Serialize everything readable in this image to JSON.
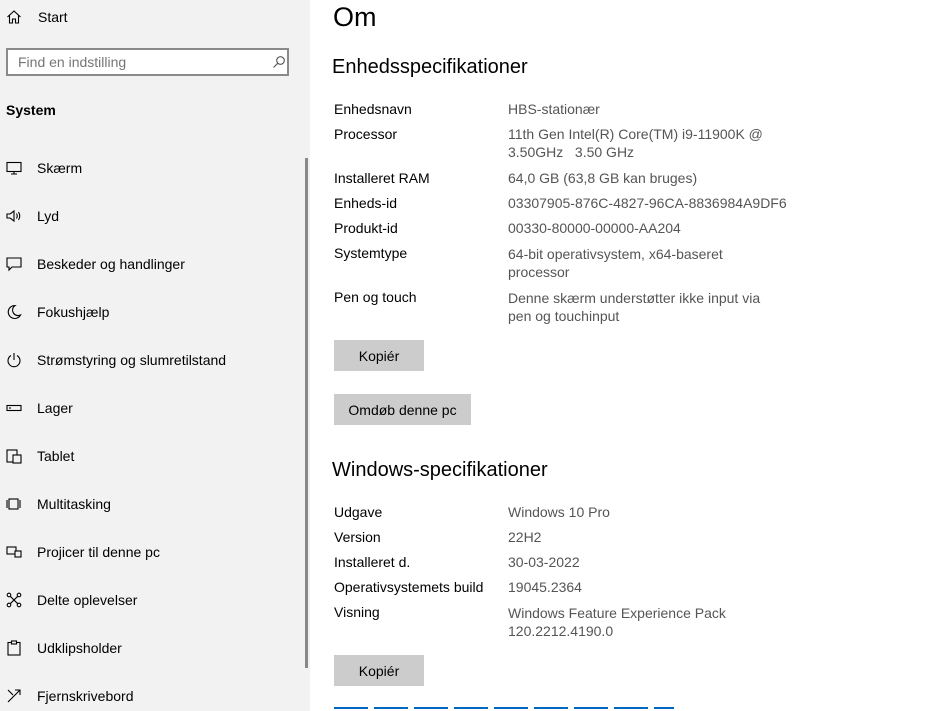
{
  "sidebar": {
    "home_label": "Start",
    "search_placeholder": "Find en indstilling",
    "section_title": "System",
    "items": [
      {
        "label": "Skærm",
        "icon": "monitor-icon"
      },
      {
        "label": "Lyd",
        "icon": "speaker-icon"
      },
      {
        "label": "Beskeder og handlinger",
        "icon": "message-icon"
      },
      {
        "label": "Fokushjælp",
        "icon": "moon-icon"
      },
      {
        "label": "Strømstyring og slumretilstand",
        "icon": "power-icon"
      },
      {
        "label": "Lager",
        "icon": "storage-icon"
      },
      {
        "label": "Tablet",
        "icon": "tablet-icon"
      },
      {
        "label": "Multitasking",
        "icon": "multitasking-icon"
      },
      {
        "label": "Projicer til denne pc",
        "icon": "project-icon"
      },
      {
        "label": "Delte oplevelser",
        "icon": "shared-experiences-icon"
      },
      {
        "label": "Udklipsholder",
        "icon": "clipboard-icon"
      },
      {
        "label": "Fjernskrivebord",
        "icon": "remote-desktop-icon"
      }
    ]
  },
  "main": {
    "title": "Om",
    "device_specs": {
      "heading": "Enhedsspecifikationer",
      "rows": [
        {
          "label": "Enhedsnavn",
          "value": [
            "HBS-stationær"
          ]
        },
        {
          "label": "Processor",
          "value": [
            "11th Gen Intel(R) Core(TM) i9-11900K @",
            "3.50GHz   3.50 GHz"
          ]
        },
        {
          "label": "Installeret RAM",
          "value": [
            "64,0 GB (63,8 GB kan bruges)"
          ]
        },
        {
          "label": "Enheds-id",
          "value": [
            "03307905-876C-4827-96CA-8836984A9DF6"
          ]
        },
        {
          "label": "Produkt-id",
          "value": [
            "00330-80000-00000-AA204"
          ]
        },
        {
          "label": "Systemtype",
          "value": [
            "64-bit operativsystem, x64-baseret",
            "processor"
          ]
        },
        {
          "label": "Pen og touch",
          "value": [
            "Denne skærm understøtter ikke input via",
            "pen og touchinput"
          ]
        }
      ],
      "copy_button": "Kopiér",
      "rename_button": "Omdøb denne pc"
    },
    "windows_specs": {
      "heading": "Windows-specifikationer",
      "rows": [
        {
          "label": "Udgave",
          "value": [
            "Windows 10 Pro"
          ]
        },
        {
          "label": "Version",
          "value": [
            "22H2"
          ]
        },
        {
          "label": "Installeret d.",
          "value": [
            "30-03-2022"
          ]
        },
        {
          "label": "Operativsystemets build",
          "value": [
            "19045.2364"
          ]
        },
        {
          "label": "Visning",
          "value": [
            "Windows Feature Experience Pack",
            "120.2212.4190.0"
          ]
        }
      ],
      "copy_button": "Kopiér"
    }
  },
  "colors": {
    "sidebar_bg": "#f2f2f2",
    "button_bg": "#cccccc",
    "value_text": "#555555",
    "link": "#0067c0"
  }
}
